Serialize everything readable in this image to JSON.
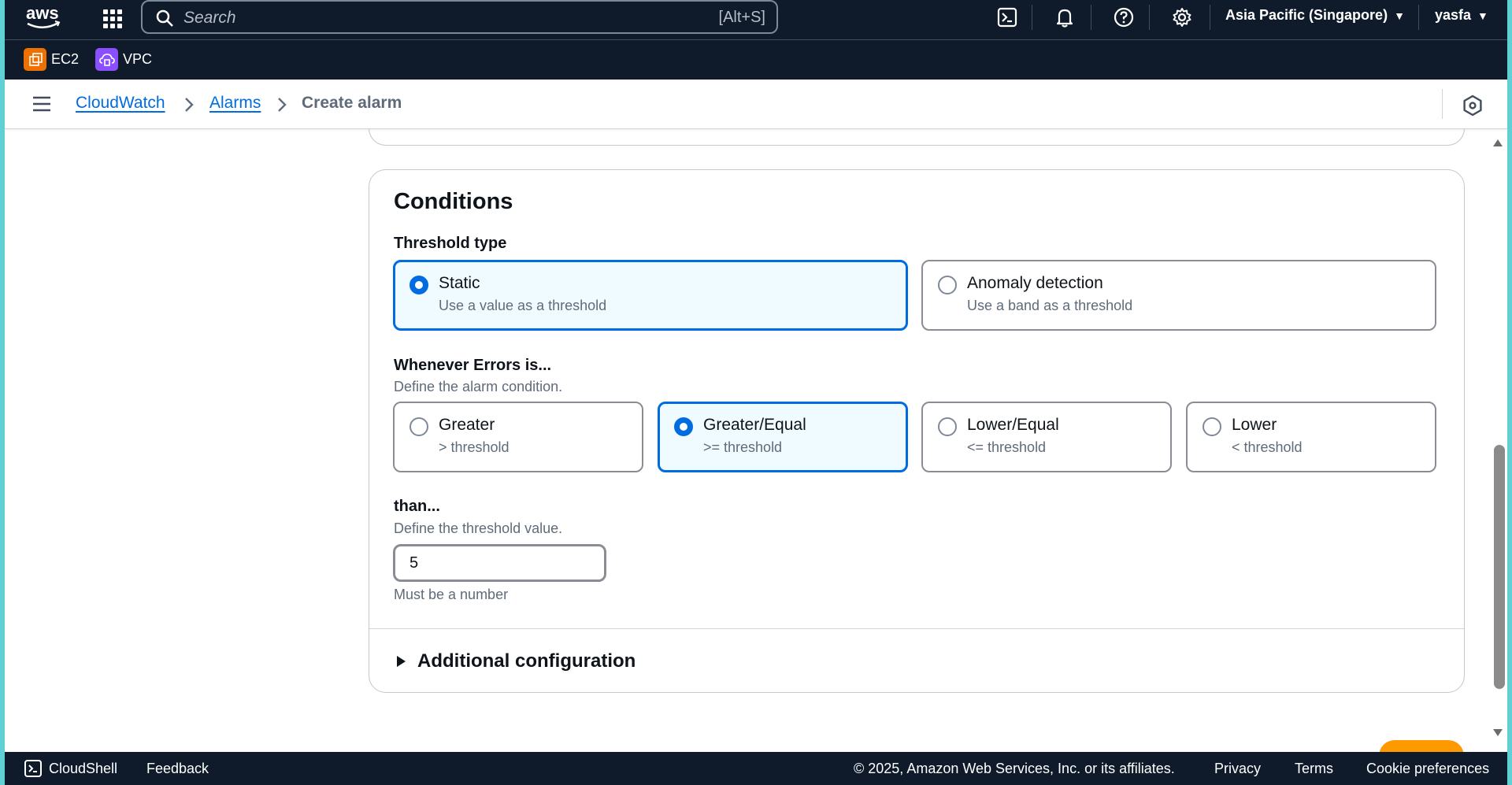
{
  "topbar": {
    "search_placeholder": "Search",
    "search_shortcut": "[Alt+S]",
    "region": "Asia Pacific (Singapore)",
    "user": "yasfa"
  },
  "favorites": [
    {
      "label": "EC2",
      "color": "#ed7100"
    },
    {
      "label": "VPC",
      "color": "#8c4fff"
    }
  ],
  "breadcrumb": {
    "items": [
      "CloudWatch",
      "Alarms"
    ],
    "current": "Create alarm"
  },
  "conditions": {
    "title": "Conditions",
    "threshold_type_label": "Threshold type",
    "threshold_types": [
      {
        "title": "Static",
        "desc": "Use a value as a threshold",
        "selected": true
      },
      {
        "title": "Anomaly detection",
        "desc": "Use a band as a threshold",
        "selected": false
      }
    ],
    "whenever_label": "Whenever Errors is...",
    "whenever_desc": "Define the alarm condition.",
    "operators": [
      {
        "title": "Greater",
        "desc": "> threshold",
        "selected": false
      },
      {
        "title": "Greater/Equal",
        "desc": ">= threshold",
        "selected": true
      },
      {
        "title": "Lower/Equal",
        "desc": "<= threshold",
        "selected": false
      },
      {
        "title": "Lower",
        "desc": "< threshold",
        "selected": false
      }
    ],
    "than_label": "than...",
    "than_desc": "Define the threshold value.",
    "threshold_value": "5",
    "threshold_hint": "Must be a number",
    "additional_config": "Additional configuration"
  },
  "footer": {
    "cloudshell": "CloudShell",
    "feedback": "Feedback",
    "copyright": "© 2025, Amazon Web Services, Inc. or its affiliates.",
    "privacy": "Privacy",
    "terms": "Terms",
    "cookies": "Cookie preferences"
  },
  "colors": {
    "nav_bg": "#0f1b2a",
    "link": "#006ce0",
    "selected_bg": "#f0fbff"
  }
}
